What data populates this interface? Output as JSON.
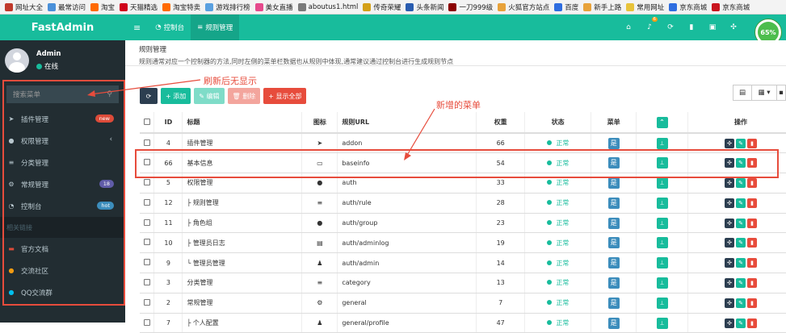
{
  "bookmarks": [
    {
      "label": "网址大全",
      "color": "#c0392b"
    },
    {
      "label": "最常访问",
      "color": "#4a90d9"
    },
    {
      "label": "淘宝",
      "color": "#ff6a00"
    },
    {
      "label": "天猫精选",
      "color": "#d0021b"
    },
    {
      "label": "淘宝特卖",
      "color": "#ff6a00"
    },
    {
      "label": "游戏排行榜",
      "color": "#5aa0e0"
    },
    {
      "label": "美女直播",
      "color": "#e64a8d"
    },
    {
      "label": "aboutus1.html",
      "color": "#7a7a7a"
    },
    {
      "label": "传奇荣耀",
      "color": "#d4a017"
    },
    {
      "label": "头条新闻",
      "color": "#2a5db0"
    },
    {
      "label": "一刀999级",
      "color": "#8b0000"
    },
    {
      "label": "火狐官方站点",
      "color": "#e8a23a"
    },
    {
      "label": "百度",
      "color": "#2e6de0"
    },
    {
      "label": "新手上路",
      "color": "#e8a23a"
    },
    {
      "label": "常用网址",
      "color": "#e8c33a"
    },
    {
      "label": "京东商城",
      "color": "#2e6de0"
    },
    {
      "label": "京东商城",
      "color": "#c9151e"
    }
  ],
  "sidebar": {
    "logo": "FastAdmin",
    "user": {
      "name": "Admin",
      "status": "在线"
    },
    "search_placeholder": "搜索菜单",
    "items": [
      {
        "label": "插件管理",
        "icon": "rocket-icon",
        "glyph": "➤",
        "badge": "new",
        "badge_color": "#dd4b39"
      },
      {
        "label": "权限管理",
        "icon": "users-icon",
        "glyph": "●",
        "chevron": "‹"
      },
      {
        "label": "分类管理",
        "icon": "list-icon",
        "glyph": "≡"
      },
      {
        "label": "常规管理",
        "icon": "cogs-icon",
        "glyph": "⚙",
        "badge": "18",
        "badge_color": "#605ca8"
      },
      {
        "label": "控制台",
        "icon": "dashboard-icon",
        "glyph": "◔",
        "badge": "hot",
        "badge_color": "#3c8dbc"
      }
    ],
    "section_header": "相关链接",
    "links": [
      {
        "label": "官方文档",
        "icon": "book-icon",
        "glyph": "▬",
        "color": "#dd4b39"
      },
      {
        "label": "交流社区",
        "icon": "comments-icon",
        "glyph": "●",
        "color": "#f39c12"
      },
      {
        "label": "QQ交流群",
        "icon": "qq-icon",
        "glyph": "●",
        "color": "#00c0ef"
      }
    ]
  },
  "topnav": {
    "menu_toggle": "≡",
    "tabs": [
      {
        "label": "控制台",
        "active": false
      },
      {
        "label": "规则管理",
        "active": true
      }
    ],
    "right_icons": [
      {
        "name": "home-icon",
        "glyph": "⌂"
      },
      {
        "name": "bell-icon",
        "glyph": "♪",
        "badge": "6"
      },
      {
        "name": "refresh-icon",
        "glyph": "⟳"
      },
      {
        "name": "trash-icon",
        "glyph": "▮"
      },
      {
        "name": "language-icon",
        "glyph": "▣"
      },
      {
        "name": "fullscreen-icon",
        "glyph": "✣"
      }
    ],
    "progress": "65%"
  },
  "page": {
    "title": "规则管理",
    "description": "规则通常对应一个控制器的方法,同时左侧的菜单栏数据也从规则中体现,通常建议通过控制台进行生成规则节点"
  },
  "toolbar": {
    "refresh": "⟳",
    "add": "+ 添加",
    "edit": "✎ 编辑",
    "delete": "🗑 删除",
    "expand": "+ 显示全部"
  },
  "colors": {
    "accent": "#18bc9c",
    "danger": "#e74c3c",
    "primary": "#3c8dbc",
    "success": "#18bc9c"
  },
  "table": {
    "headers": [
      "",
      "ID",
      "标题",
      "图标",
      "规则URL",
      "权重",
      "状态",
      "菜单",
      "",
      "操作"
    ],
    "status_text": "正常",
    "menu_badge": "是",
    "rows": [
      {
        "id": "4",
        "title": "插件管理",
        "icon": "➤",
        "url": "addon",
        "weigh": "66"
      },
      {
        "id": "66",
        "title": "基本信息",
        "icon": "▭",
        "url": "baseinfo",
        "weigh": "54"
      },
      {
        "id": "5",
        "title": "权限管理",
        "icon": "●",
        "url": "auth",
        "weigh": "33"
      },
      {
        "id": "12",
        "title": "├ 规则管理",
        "icon": "≡",
        "url": "auth/rule",
        "weigh": "28"
      },
      {
        "id": "11",
        "title": "├ 角色组",
        "icon": "●",
        "url": "auth/group",
        "weigh": "23"
      },
      {
        "id": "10",
        "title": "├ 管理员日志",
        "icon": "▤",
        "url": "auth/adminlog",
        "weigh": "19"
      },
      {
        "id": "9",
        "title": "└ 管理员管理",
        "icon": "♟",
        "url": "auth/admin",
        "weigh": "14"
      },
      {
        "id": "3",
        "title": "分类管理",
        "icon": "≡",
        "url": "category",
        "weigh": "13"
      },
      {
        "id": "2",
        "title": "常规管理",
        "icon": "⚙",
        "url": "general",
        "weigh": "7"
      },
      {
        "id": "7",
        "title": "├ 个人配置",
        "icon": "♟",
        "url": "general/profile",
        "weigh": "47"
      }
    ]
  },
  "annotations": {
    "search_note": "刷新后无显示",
    "new_menu_note": "新增的菜单"
  }
}
